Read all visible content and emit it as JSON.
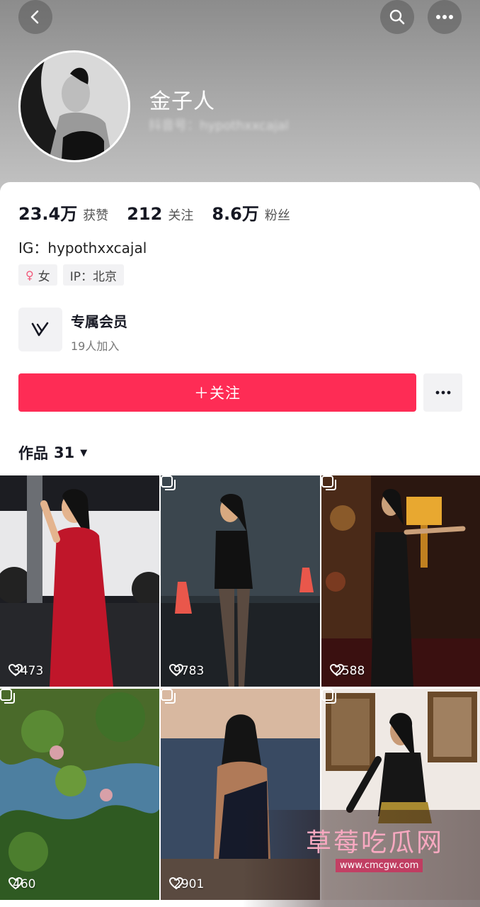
{
  "profile": {
    "name": "金子人",
    "douyin_id": "抖音号：hypothxxcajal"
  },
  "stats": [
    {
      "value": "23.4万",
      "label": "获赞"
    },
    {
      "value": "212",
      "label": "关注"
    },
    {
      "value": "8.6万",
      "label": "粉丝"
    }
  ],
  "bio": "IG：hypothxxcajal",
  "tags": {
    "gender": "女",
    "ip": "IP：北京"
  },
  "member": {
    "title": "专属会员",
    "subtitle": "19人加入"
  },
  "follow_label": "＋关注",
  "works": {
    "label": "作品",
    "count": "31"
  },
  "posts": [
    {
      "likes": "3473",
      "multi": false
    },
    {
      "likes": "9783",
      "multi": true
    },
    {
      "likes": "2588",
      "multi": true
    },
    {
      "likes": "460",
      "multi": true
    },
    {
      "likes": "2901",
      "multi": true
    },
    {
      "likes": "",
      "multi": true
    }
  ],
  "watermark": {
    "title": "草莓吃瓜网",
    "url": "www.cmcgw.com"
  },
  "colors": {
    "accent": "#fe2c55",
    "text": "#161823"
  }
}
